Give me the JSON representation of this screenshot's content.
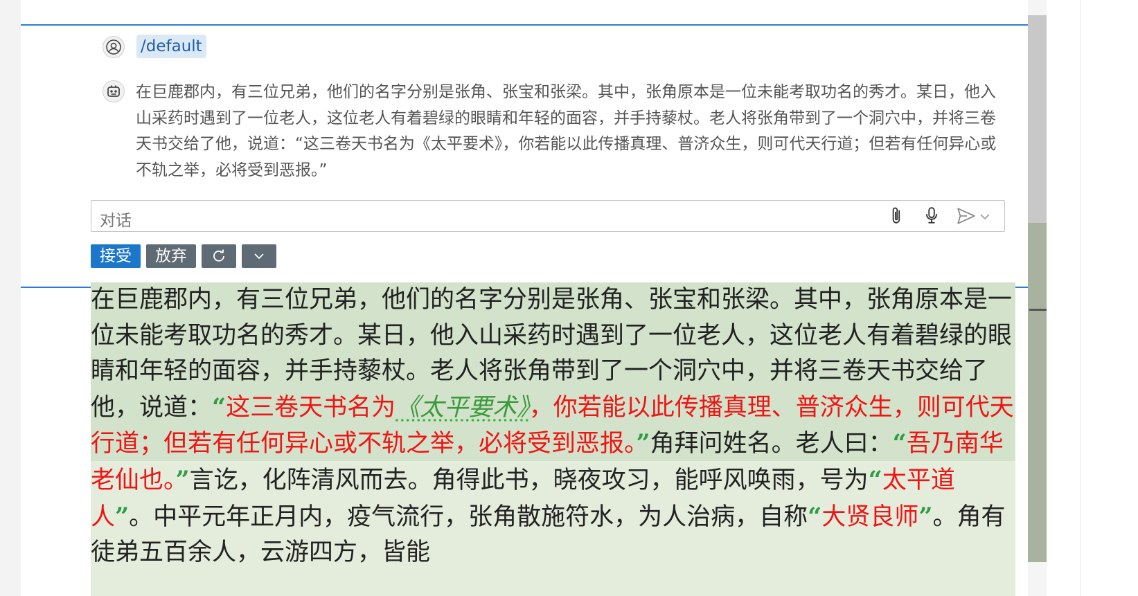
{
  "chat": {
    "user_command": "/default",
    "response": "在巨鹿郡内，有三位兄弟，他们的名字分别是张角、张宝和张梁。其中，张角原本是一位未能考取功名的秀才。某日，他入山采药时遇到了一位老人，这位老人有着碧绿的眼睛和年轻的面容，并手持藜杖。老人将张角带到了一个洞穴中，并将三卷天书交给了他，说道：“这三卷天书名为《太平要术》，你若能以此传播真理、普济众生，则可代天行道；但若有任何异心或不轨之举，必将受到恶报。”",
    "input_placeholder": "对话"
  },
  "buttons": {
    "accept": "接受",
    "discard": "放弃"
  },
  "icons": {
    "user": "user-avatar-icon",
    "bot": "bot-avatar-icon",
    "attach": "paperclip-icon",
    "mic": "microphone-icon",
    "send": "send-icon",
    "send_dropdown": "chevron-down-icon",
    "retry": "refresh-icon",
    "more": "chevron-down-icon"
  },
  "colors": {
    "accent": "#2b7bd3",
    "accept_button": "#1b77c9",
    "secondary_button": "#5e6a74",
    "changed_text": "#f01515",
    "diff_highlight": "#d2e2cb"
  },
  "editor": {
    "s1": "在巨鹿郡内，有三位兄弟，他们的名字分别是张角、张宝和张梁。其中，张角原本是一位未能考取功名的秀才。某日，他入山采药时遇到了一位老人，这位老人有着碧绿的眼睛和年轻的面容，并手持藜杖。老人将张角带到了一个洞穴中，并将三卷天书交给了他，说道：",
    "q1_open": "“",
    "q1a": "这三卷天书名为",
    "book": "《太平要术》",
    "q1b": "，你若能以此传播真理、普济众生，则可代天行道；但若有任何异心或不轨之举，必将受到恶报。",
    "q1_close": "”",
    "s2": "角拜问姓名。老人曰：",
    "q2_open": "“",
    "q2": "吾乃南华老仙也。",
    "q2_close": "”",
    "s3": "言讫，化阵清风而去。角得此书，晓夜攻习，能呼风唤雨，号为",
    "q3_open": "“",
    "q3": "太平道人",
    "q3_close": "”",
    "s4": "。中平元年正月内，疫气流行，张角散施符水，为人治病，自称",
    "q4_open": "“",
    "q4": "大贤良师",
    "q4_close": "”",
    "s5": "。角有徒弟五百余人，云游四方，皆能"
  }
}
